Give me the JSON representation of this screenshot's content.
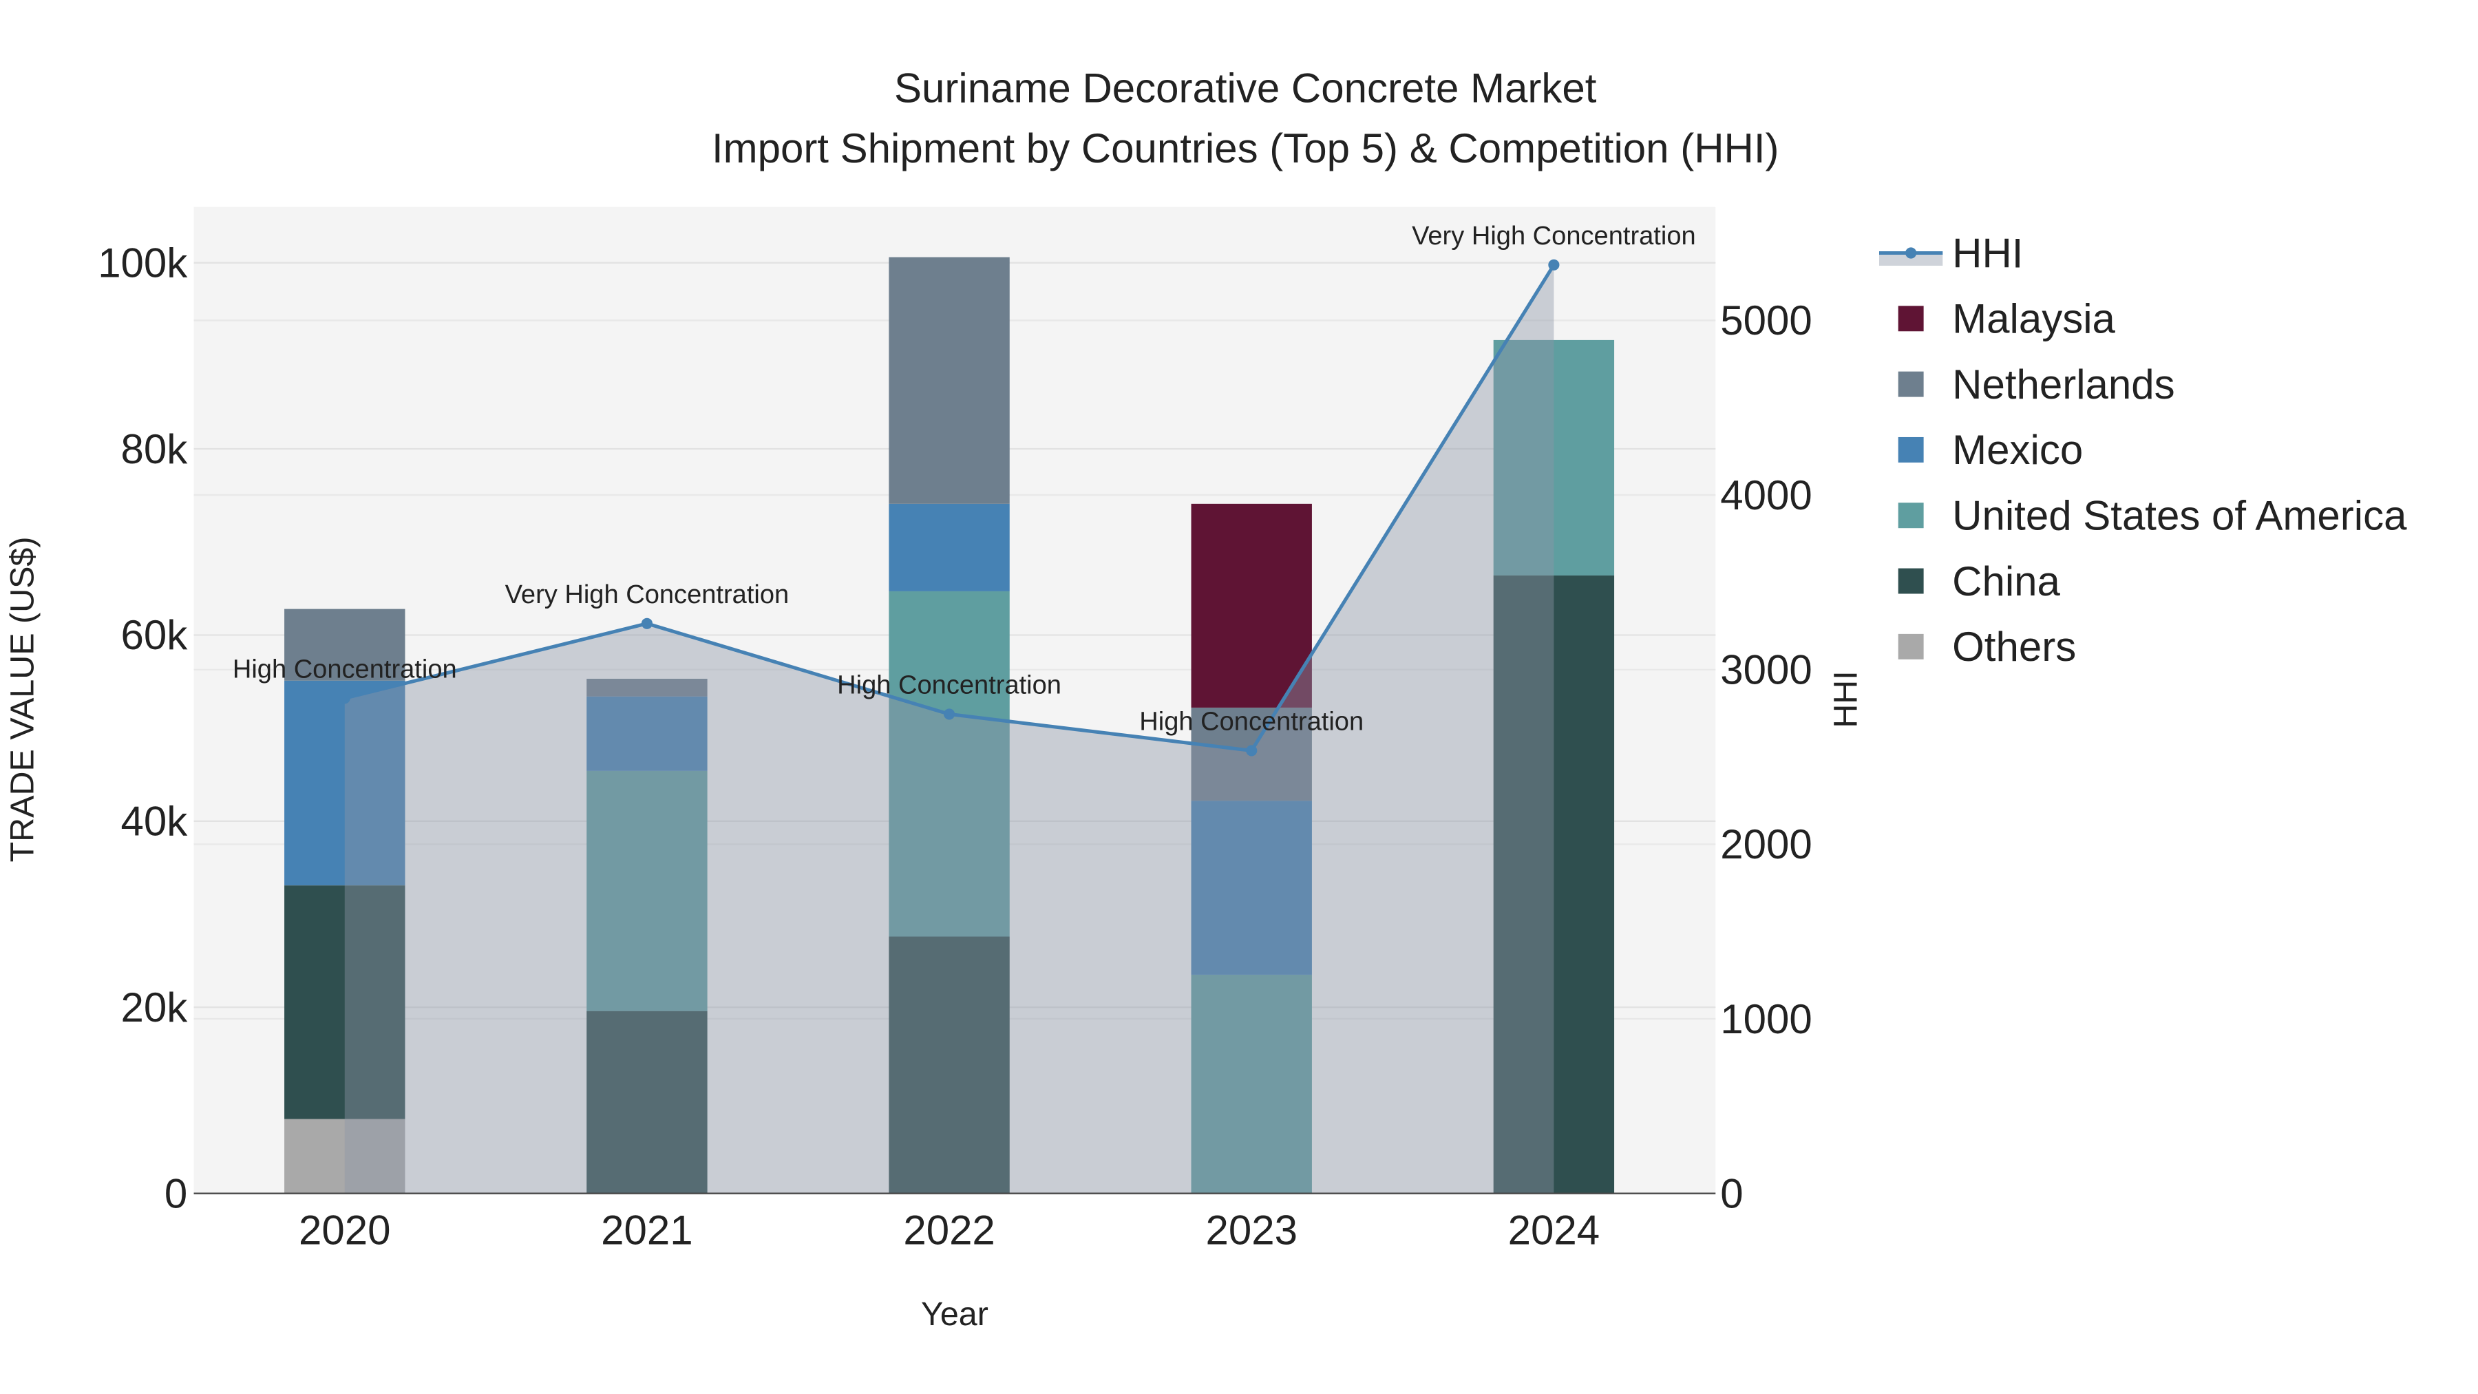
{
  "chart_data": {
    "type": "bar",
    "title": "Suriname Decorative Concrete Market",
    "subtitle": "Import Shipment by Countries (Top 5) & Competition (HHI)",
    "xlabel": "Year",
    "ylabel": "TRADE VALUE (US$)",
    "y2label": "HHI",
    "categories": [
      "2020",
      "2021",
      "2022",
      "2023",
      "2024"
    ],
    "ylim": [
      0,
      106000
    ],
    "y2lim": [
      0,
      5650
    ],
    "yticks": [
      0,
      20000,
      40000,
      60000,
      80000,
      100000
    ],
    "ytick_labels": [
      "0",
      "20k",
      "40k",
      "60k",
      "80k",
      "100k"
    ],
    "y2ticks": [
      0,
      1000,
      2000,
      3000,
      4000,
      5000
    ],
    "y2tick_labels": [
      "0",
      "1000",
      "2000",
      "3000",
      "4000",
      "5000"
    ],
    "grid": true,
    "legend_position": "right",
    "series": [
      {
        "name": "Others",
        "color": "#a9a9a9",
        "values": [
          8000,
          0,
          0,
          0,
          0
        ]
      },
      {
        "name": "China",
        "color": "#2f4f4f",
        "values": [
          25100,
          19600,
          27600,
          0,
          66400
        ]
      },
      {
        "name": "United States of America",
        "color": "#5f9ea0",
        "values": [
          0,
          25800,
          37100,
          23500,
          25300
        ]
      },
      {
        "name": "Mexico",
        "color": "#4682b4",
        "values": [
          22000,
          8000,
          9400,
          18700,
          0
        ]
      },
      {
        "name": "Netherlands",
        "color": "#6e7f8e",
        "values": [
          7700,
          1900,
          26500,
          10000,
          0
        ]
      },
      {
        "name": "Malaysia",
        "color": "#5f1434",
        "values": [
          0,
          0,
          0,
          21900,
          0
        ]
      }
    ],
    "hhi": {
      "name": "HHI",
      "color": "#4682b4",
      "values": [
        2836,
        3264,
        2745,
        2536,
        5318
      ],
      "annotations": [
        "High Concentration",
        "Very High Concentration",
        "High Concentration",
        "High Concentration",
        "Very High Concentration"
      ]
    },
    "legend_order": [
      "HHI",
      "Malaysia",
      "Netherlands",
      "Mexico",
      "United States of America",
      "China",
      "Others"
    ]
  }
}
